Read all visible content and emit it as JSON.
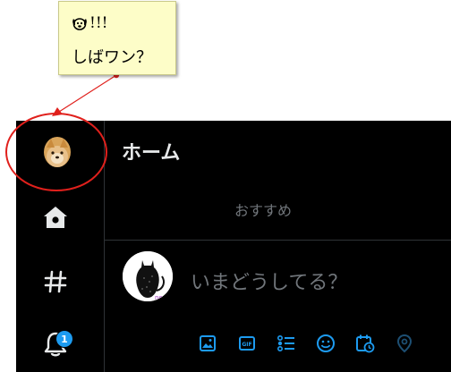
{
  "annotation": {
    "note_exclaim": "!!!",
    "note_text": "しばワン？",
    "note_icon": "dog-face-icon",
    "highlight_color": "#e0201c"
  },
  "nav": {
    "items": [
      {
        "name": "profile-avatar",
        "icon": "shiba-avatar-icon"
      },
      {
        "name": "home",
        "icon": "home-icon"
      },
      {
        "name": "explore",
        "icon": "hashtag-icon"
      },
      {
        "name": "notifications",
        "icon": "bell-icon",
        "badge": "1"
      }
    ]
  },
  "header": {
    "title": "ホーム"
  },
  "tabs": {
    "recommended": "おすすめ"
  },
  "compose": {
    "placeholder": "いまどうしてる？",
    "avatar": "cat-silhouette-avatar",
    "tools": [
      "image-icon",
      "gif-icon",
      "poll-icon",
      "emoji-icon",
      "schedule-icon",
      "location-icon"
    ]
  },
  "colors": {
    "background": "#000000",
    "accent": "#1d9bf0",
    "muted_text": "#71767b",
    "primary_text": "#e7e9ea",
    "note_bg": "#fdfdc8"
  }
}
